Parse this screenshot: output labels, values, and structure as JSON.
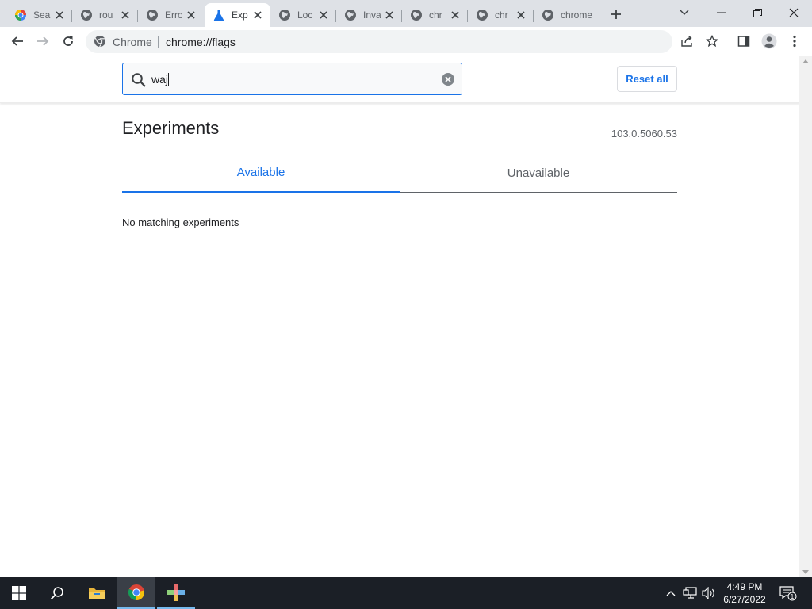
{
  "browser": {
    "tabs": [
      {
        "title": "Sea",
        "icon": "google-icon",
        "active": false
      },
      {
        "title": "rou",
        "icon": "globe-icon",
        "active": false
      },
      {
        "title": "Erro",
        "icon": "globe-icon",
        "active": false
      },
      {
        "title": "Exp",
        "icon": "flask-icon",
        "active": true
      },
      {
        "title": "Loc",
        "icon": "globe-icon",
        "active": false
      },
      {
        "title": "Inva",
        "icon": "globe-icon",
        "active": false
      },
      {
        "title": "chr",
        "icon": "globe-icon",
        "active": false
      },
      {
        "title": "chr",
        "icon": "globe-icon",
        "active": false
      },
      {
        "title": "chrome",
        "icon": "globe-icon",
        "active": false
      }
    ],
    "omnibox": {
      "chip": "Chrome",
      "url": "chrome://flags"
    }
  },
  "flags": {
    "search_value": "waj",
    "reset_label": "Reset all",
    "title": "Experiments",
    "version": "103.0.5060.53",
    "tab_available": "Available",
    "tab_unavailable": "Unavailable",
    "no_match": "No matching experiments"
  },
  "taskbar": {
    "time": "4:49 PM",
    "date": "6/27/2022",
    "notification_count": "1"
  },
  "colors": {
    "accent": "#1a73e8",
    "tabstrip": "#dee1e6",
    "taskbar": "#1b1f26"
  }
}
